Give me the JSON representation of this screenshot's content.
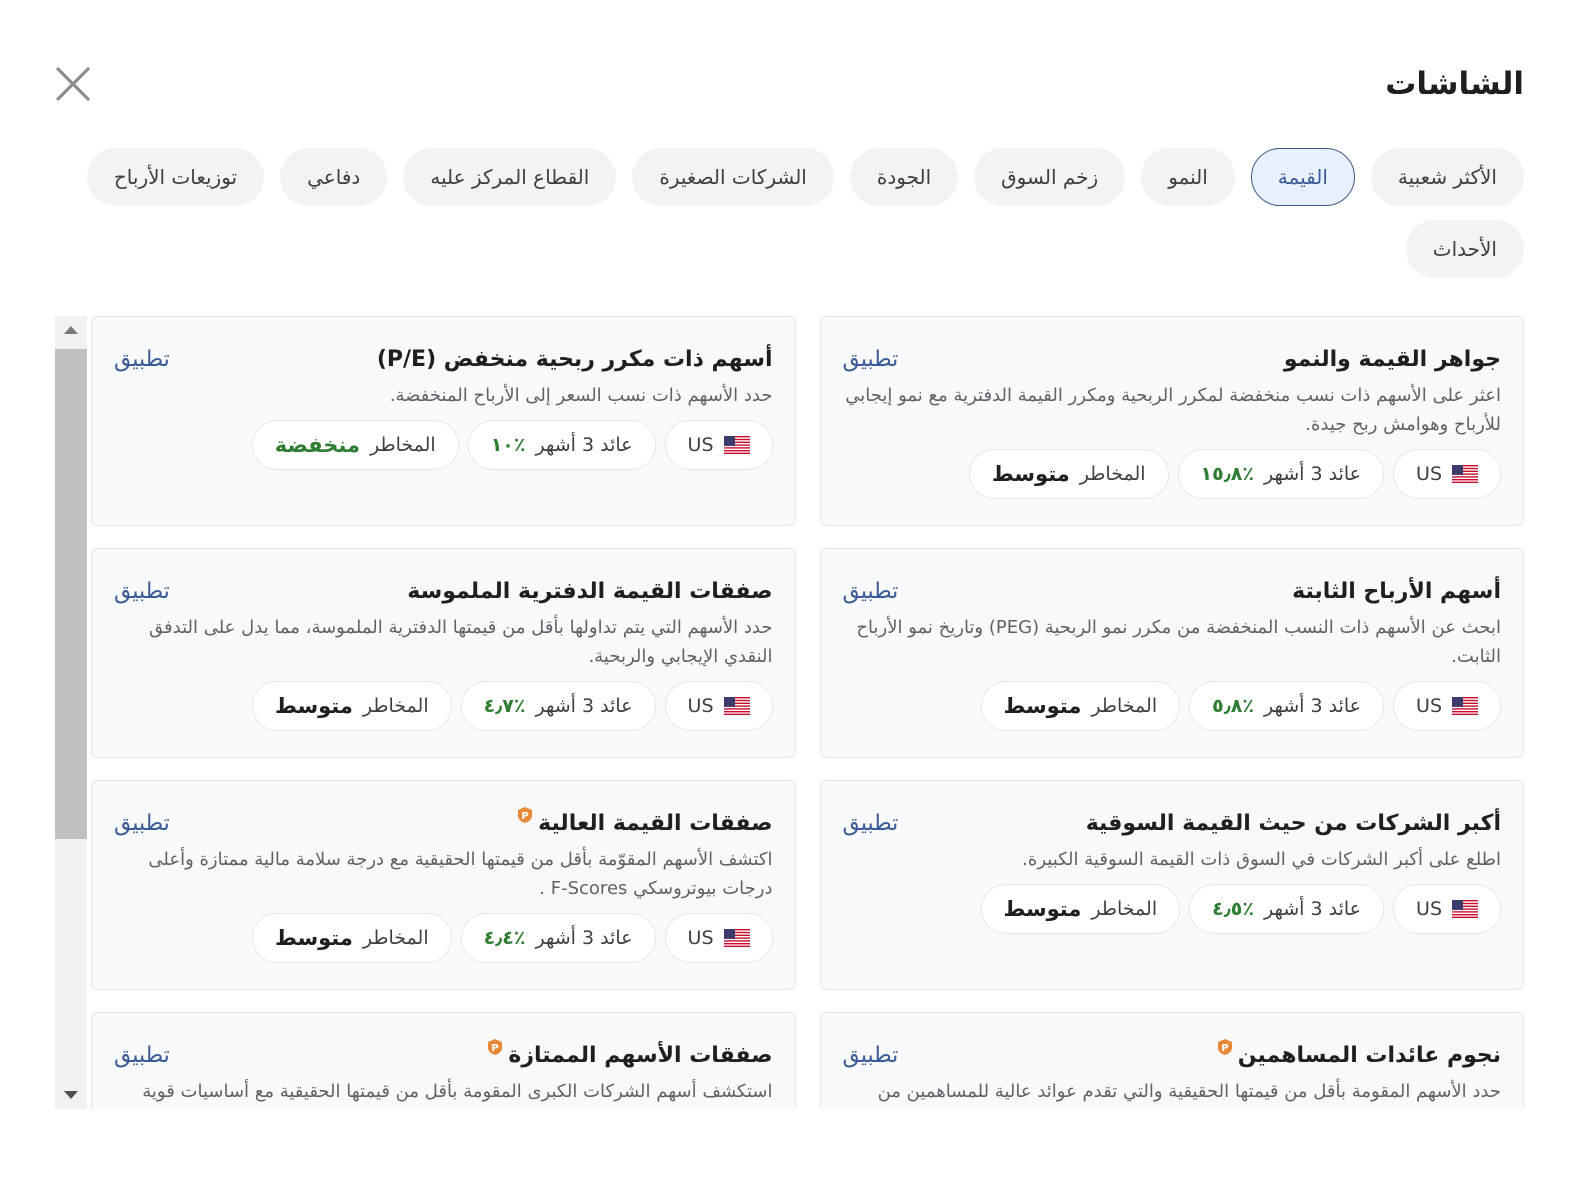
{
  "header": {
    "title": "الشاشات"
  },
  "chips": [
    {
      "label": "الأكثر شعبية",
      "active": false
    },
    {
      "label": "القيمة",
      "active": true
    },
    {
      "label": "النمو",
      "active": false
    },
    {
      "label": "زخم السوق",
      "active": false
    },
    {
      "label": "الجودة",
      "active": false
    },
    {
      "label": "الشركات الصغيرة",
      "active": false
    },
    {
      "label": "القطاع المركز عليه",
      "active": false
    },
    {
      "label": "دفاعي",
      "active": false
    },
    {
      "label": "توزيعات الأرباح",
      "active": false
    },
    {
      "label": "الأحداث",
      "active": false
    }
  ],
  "labels": {
    "apply": "تطبيق",
    "country": "US",
    "return_prefix": "عائد 3 أشهر",
    "risk_prefix": "المخاطر"
  },
  "cards": [
    {
      "title": "جواهر القيمة والنمو",
      "pro": false,
      "desc": "اعثر على الأسهم ذات نسب منخفضة لمكرر الربحية ومكرر القيمة الدفترية مع نمو إيجابي للأرباح وهوامش ربح جيدة.",
      "return": "٪١٥٫٨",
      "risk": "متوسط",
      "risk_level": "medium"
    },
    {
      "title": "أسهم ذات مكرر ربحية منخفض (P/E)",
      "pro": false,
      "desc": "حدد الأسهم ذات نسب السعر إلى الأرباح المنخفضة.",
      "return": "٪١٠",
      "risk": "منخفضة",
      "risk_level": "low"
    },
    {
      "title": "أسهم الأرباح الثابتة",
      "pro": false,
      "desc": "ابحث عن الأسهم ذات النسب المنخفضة من مكرر نمو الربحية (PEG) وتاريخ نمو الأرباح الثابت.",
      "return": "٪٥٫٨",
      "risk": "متوسط",
      "risk_level": "medium"
    },
    {
      "title": "صفقات القيمة الدفترية الملموسة",
      "pro": false,
      "desc": "حدد الأسهم التي يتم تداولها بأقل من قيمتها الدفترية الملموسة، مما يدل على التدفق النقدي الإيجابي والربحية.",
      "return": "٪٤٫٧",
      "risk": "متوسط",
      "risk_level": "medium"
    },
    {
      "title": "أكبر الشركات من حيث القيمة السوقية",
      "pro": false,
      "desc": "اطلع على أكبر الشركات في السوق ذات القيمة السوقية الكبيرة.",
      "return": "٪٤٫٥",
      "risk": "متوسط",
      "risk_level": "medium"
    },
    {
      "title": "صفقات القيمة العالية",
      "pro": true,
      "desc": "اكتشف الأسهم المقوّمة بأقل من قيمتها الحقيقية مع درجة سلامة مالية ممتازة وأعلى درجات بيوتروسكي F-Scores .",
      "return": "٪٤٫٤",
      "risk": "متوسط",
      "risk_level": "medium"
    },
    {
      "title": "نجوم عائدات المساهمين",
      "pro": true,
      "desc": "حدد الأسهم المقومة بأقل من قيمتها الحقيقية والتي تقدم عوائد عالية للمساهمين من",
      "return": "",
      "risk": "",
      "risk_level": "medium"
    },
    {
      "title": "صفقات الأسهم الممتازة",
      "pro": true,
      "desc": "استكشف أسهم الشركات الكبرى المقومة بأقل من قيمتها الحقيقية مع أساسيات قوية",
      "return": "",
      "risk": "",
      "risk_level": "medium"
    }
  ],
  "colors": {
    "accent": "#3a5a99",
    "positive": "#2e7d32",
    "chip_bg": "#f1f3f4",
    "card_bg": "#f8f9fb"
  }
}
